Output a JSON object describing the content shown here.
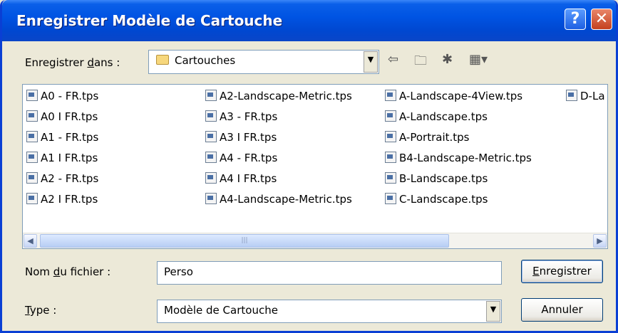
{
  "window": {
    "title": "Enregistrer Modèle de Cartouche",
    "help_glyph": "?",
    "close_glyph": "✕"
  },
  "location": {
    "label_pre": "Enregistrer ",
    "label_u": "d",
    "label_post": "ans :",
    "value": "Cartouches",
    "folder_icon": "folder-icon"
  },
  "toolbar": {
    "back": "⇦",
    "up": "🗀",
    "new_folder": "✱",
    "view": "▦▾"
  },
  "files": {
    "col1": [
      "A0 - FR.tps",
      "A0 I FR.tps",
      "A1 - FR.tps",
      "A1 I FR.tps",
      "A2 - FR.tps",
      "A2 I FR.tps"
    ],
    "col2": [
      "A2-Landscape-Metric.tps",
      "A3 - FR.tps",
      "A3 I FR.tps",
      "A4 - FR.tps",
      "A4 I FR.tps",
      "A4-Landscape-Metric.tps"
    ],
    "col3": [
      "A-Landscape-4View.tps",
      "A-Landscape.tps",
      "A-Portrait.tps",
      "B4-Landscape-Metric.tps",
      "B-Landscape.tps",
      "C-Landscape.tps"
    ],
    "col4": [
      "D-La"
    ]
  },
  "filename": {
    "label_pre": "Nom ",
    "label_u": "d",
    "label_post": "u fichier :",
    "value": "Perso"
  },
  "type": {
    "label_u": "T",
    "label_post": "ype :",
    "value": "Modèle de Cartouche"
  },
  "buttons": {
    "save_u": "E",
    "save_rest": "nregistrer",
    "cancel": "Annuler"
  },
  "scrollbar": {
    "left": "◀",
    "right": "▶",
    "grip": "|||"
  }
}
